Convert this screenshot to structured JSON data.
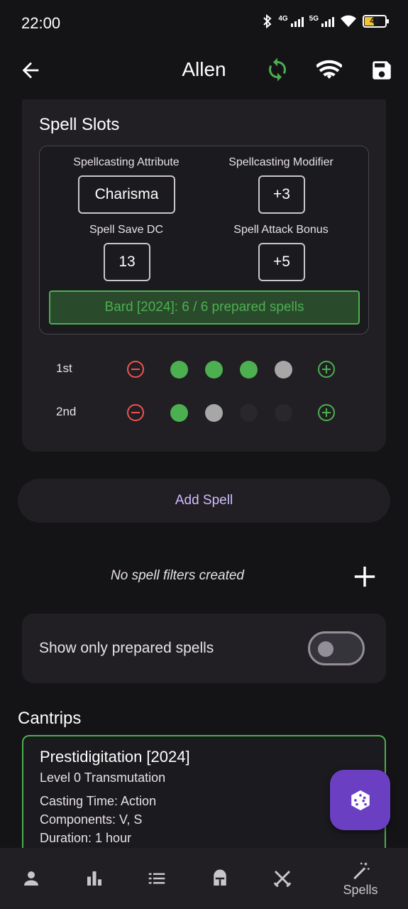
{
  "status_bar": {
    "time": "22:00",
    "net1": "4G",
    "net2": "5G",
    "battery": "42"
  },
  "app_bar": {
    "title": "Allen"
  },
  "spell_slots": {
    "heading": "Spell Slots",
    "spellcasting_attribute_label": "Spellcasting Attribute",
    "spellcasting_attribute_value": "Charisma",
    "spellcasting_modifier_label": "Spellcasting Modifier",
    "spellcasting_modifier_value": "+3",
    "spell_save_dc_label": "Spell Save DC",
    "spell_save_dc_value": "13",
    "spell_attack_bonus_label": "Spell Attack Bonus",
    "spell_attack_bonus_value": "+5",
    "prepared_text": "Bard [2024]: 6 / 6 prepared spells",
    "levels": [
      {
        "label": "1st",
        "slots": [
          "used",
          "used",
          "used",
          "avail"
        ]
      },
      {
        "label": "2nd",
        "slots": [
          "used",
          "avail",
          "empty",
          "empty"
        ]
      }
    ]
  },
  "add_spell_label": "Add Spell",
  "filters": {
    "empty_text": "No spell filters created"
  },
  "prepared_toggle": {
    "label": "Show only prepared spells",
    "on": false
  },
  "cantrips": {
    "heading": "Cantrips",
    "items": [
      {
        "name": "Prestidigitation [2024]",
        "school": "Level 0 Transmutation",
        "casting_time": "Casting Time: Action",
        "components": "Components: V, S",
        "duration": "Duration: 1 hour"
      }
    ]
  },
  "bottom_nav": {
    "spells_label": "Spells"
  },
  "colors": {
    "accent_green": "#4caf50",
    "accent_red": "#ef5350",
    "fab_purple": "#6a3fc2",
    "link_purple": "#cfbcff"
  }
}
